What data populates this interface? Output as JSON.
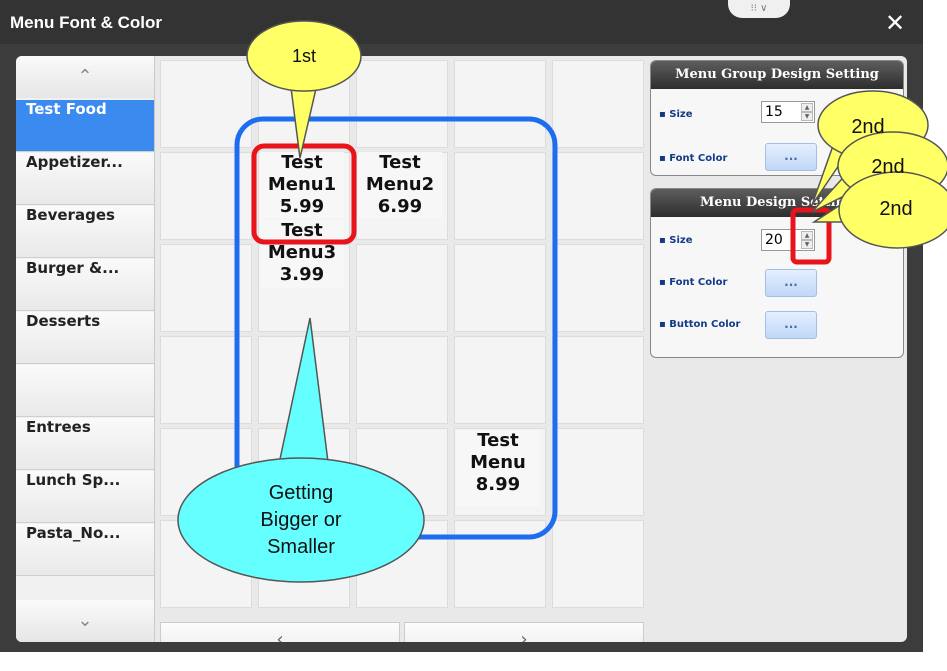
{
  "window": {
    "title": "Menu Font & Color",
    "close_label": "✕",
    "handle_label": "⁝⁝ ∨"
  },
  "sidebar": {
    "up_arrow": "⌃",
    "down_arrow": "⌄",
    "items": [
      {
        "label": "Test Food",
        "active": true
      },
      {
        "label": "Appetizer..."
      },
      {
        "label": "Beverages"
      },
      {
        "label": "Burger &..."
      },
      {
        "label": "Desserts"
      },
      {
        "label": ""
      },
      {
        "label": "Entrees"
      },
      {
        "label": "Lunch Sp..."
      },
      {
        "label": "Pasta_No..."
      }
    ]
  },
  "grid": {
    "menu_items": [
      {
        "text": "Test\nMenu1\n5.99"
      },
      {
        "text": "Test\nMenu2\n6.99"
      },
      {
        "text": "Test\nMenu3\n3.99"
      },
      {
        "text": "Test\nMenu\n8.99"
      }
    ],
    "prev_label": "‹",
    "next_label": "›"
  },
  "group_panel": {
    "title": "Menu Group Design Setting",
    "size_label": "▪ Size",
    "size_value": "15",
    "font_color_label": "▪ Font Color",
    "font_color_button": "..."
  },
  "menu_panel": {
    "title": "Menu Design Setting",
    "size_label": "▪ Size",
    "size_value": "20",
    "font_color_label": "▪ Font Color",
    "font_color_button": "...",
    "button_color_label": "▪ Button Color",
    "button_color_button": "..."
  },
  "annotations": {
    "first": "1st",
    "second_a": "2nd",
    "second_b": "2nd",
    "second_c": "2nd",
    "bubble": "Getting\nBigger or\nSmaller"
  },
  "colors": {
    "accent": "#3b8af0",
    "highlight_red": "#e8141b",
    "group_blue": "#1e6df0",
    "callout_yellow": "#ffff66",
    "callout_cyan": "#66ffff"
  }
}
